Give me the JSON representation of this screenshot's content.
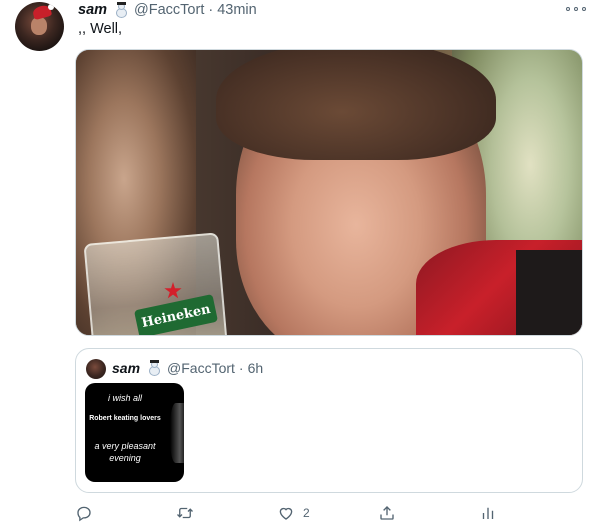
{
  "tweet": {
    "author": {
      "name": "sam",
      "handle": "@FaccTort",
      "time": "43min"
    },
    "separator": "·",
    "text": ",, Well,",
    "media": {
      "brand_label": "Heineken"
    },
    "quoted": {
      "name": "sam",
      "handle": "@FaccTort",
      "time": "6h",
      "image_lines": {
        "line1": "i wish all",
        "line2": "Robert keating lovers",
        "line3": "a very pleasant evening"
      }
    },
    "actions": {
      "reply_icon": "reply-icon",
      "retweet_icon": "retweet-icon",
      "like_icon": "heart-icon",
      "like_count": "2",
      "share_icon": "share-icon",
      "analytics_icon": "analytics-icon"
    },
    "colors": {
      "text_primary": "#0f1419",
      "text_secondary": "#536471",
      "border": "#cfd9de"
    }
  }
}
